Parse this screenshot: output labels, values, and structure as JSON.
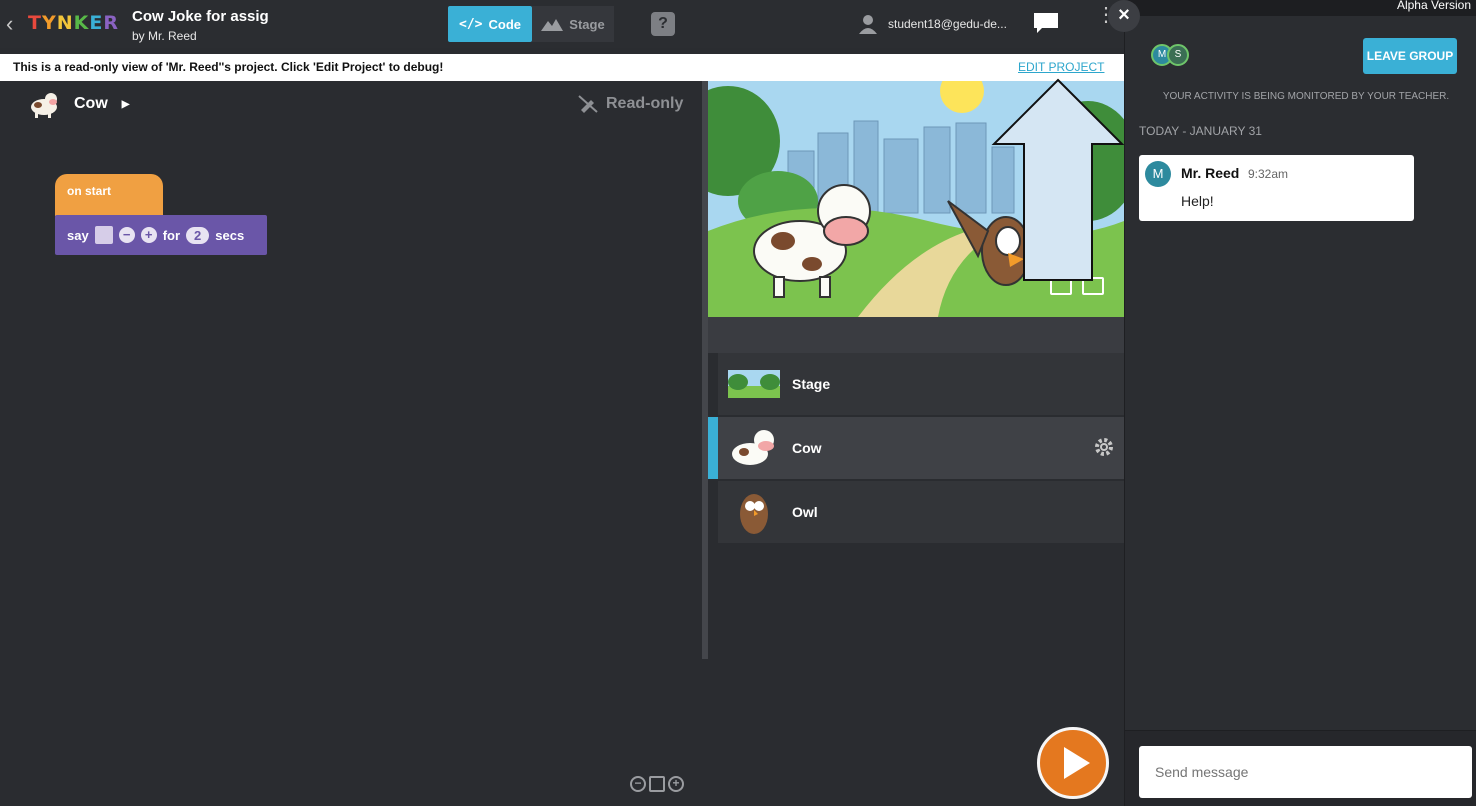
{
  "header": {
    "logo_text": "TYNKER",
    "project_title": "Cow Joke for assig",
    "project_author": "by Mr. Reed",
    "tab_code": "Code",
    "tab_stage": "Stage",
    "help": "?",
    "user_email": "student18@gedu-de..."
  },
  "banner": {
    "message": "This is a read-only view of 'Mr. Reed''s project. Click 'Edit Project' to debug!",
    "edit_link": "EDIT PROJECT"
  },
  "workspace": {
    "sprite_name": "Cow",
    "read_only_label": "Read-only",
    "blocks": {
      "on_start": "on start",
      "say": "say",
      "for": "for",
      "secs_value": "2",
      "secs": "secs"
    }
  },
  "sprites": [
    {
      "name": "Stage"
    },
    {
      "name": "Cow"
    },
    {
      "name": "Owl"
    }
  ],
  "chat": {
    "alpha": "Alpha Version",
    "close": "×",
    "avatar_1": "M",
    "avatar_2": "S",
    "leave_group": "LEAVE GROUP",
    "monitored_notice": "YOUR ACTIVITY IS BEING MONITORED BY YOUR TEACHER.",
    "date_label": "TODAY - JANUARY 31",
    "message": {
      "avatar": "M",
      "author": "Mr. Reed",
      "time": "9:32am",
      "text": "Help!"
    },
    "compose_placeholder": "Send message"
  },
  "colors": {
    "accent": "#3ab0d6",
    "event_block": "#f0a042",
    "looks_block": "#6a56a8",
    "play": "#e4781f"
  }
}
